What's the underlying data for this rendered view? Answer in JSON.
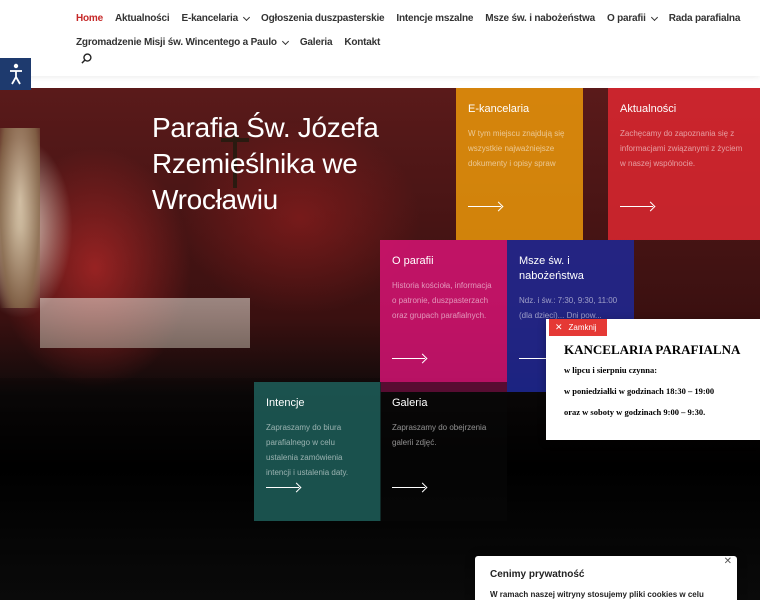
{
  "nav": {
    "row1": [
      {
        "label": "Home",
        "active": true,
        "dropdown": false
      },
      {
        "label": "Aktualności",
        "dropdown": false
      },
      {
        "label": "E-kancelaria",
        "dropdown": true
      },
      {
        "label": "Ogłoszenia duszpasterskie",
        "dropdown": false
      },
      {
        "label": "Intencje mszalne",
        "dropdown": false
      },
      {
        "label": "Msze św. i nabożeństwa",
        "dropdown": false
      },
      {
        "label": "O parafii",
        "dropdown": true
      },
      {
        "label": "Rada parafialna",
        "dropdown": false
      }
    ],
    "row2": [
      {
        "label": "Zgromadzenie Misji św. Wincentego a Paulo",
        "dropdown": true
      },
      {
        "label": "Galeria",
        "dropdown": false
      },
      {
        "label": "Kontakt",
        "dropdown": false
      }
    ]
  },
  "hero": {
    "title": "Parafia Św. Józefa Rzemieślnika we Wrocławiu"
  },
  "tiles": [
    {
      "id": "ekancelaria",
      "title": "E-kancelaria",
      "desc": "W tym miejscu znajdują się wszystkie najważniejsze dokumenty i opisy spraw",
      "color": "rgba(240,156,10,0.82)"
    },
    {
      "id": "aktualnosci",
      "title": "Aktualności",
      "desc": "Zachęcamy do zapoznania się z informacjami związanymi z życiem w naszej wspólnocie.",
      "color": "rgba(230,40,50,0.80)"
    },
    {
      "id": "oparafii",
      "title": "O parafii",
      "desc": "Historia kościoła, informacja o patronie, duszpasterzach oraz grupach parafialnych.",
      "color": "rgba(220,20,120,0.82)"
    },
    {
      "id": "msze",
      "title": "Msze św. i nabożeństwa",
      "desc": "Ndz. i św.: 7:30, 9:30, 11:00 (dla dzieci)... Dni pow...",
      "color": "rgba(30,40,150,0.85)"
    },
    {
      "id": "intencje",
      "title": "Intencje",
      "desc": "Zapraszamy do biura parafialnego w celu ustalenia zamówienia intencji i ustalenia daty.",
      "color": "rgba(30,95,90,0.85)"
    },
    {
      "id": "galeria",
      "title": "Galeria",
      "desc": "Zapraszamy do obejrzenia galerii zdjęć.",
      "color": "rgba(10,10,10,0.55)"
    }
  ],
  "popup": {
    "close_label": "Zamknij",
    "title": "KANCELARIA PARAFIALNA",
    "line1": "w lipcu i sierpniu czynna:",
    "line2": "w poniedziałki w godzinach 18:30 – 19:00",
    "line3": "oraz w soboty w godzinach 9:00 – 9:30."
  },
  "privacy": {
    "title": "Cenimy prywatność",
    "text": "W ramach naszej witryny stosujemy pliki cookies w celu"
  },
  "colors": {
    "accent": "#c62828",
    "a11y": "#1e3a6e",
    "close": "#e53935"
  }
}
